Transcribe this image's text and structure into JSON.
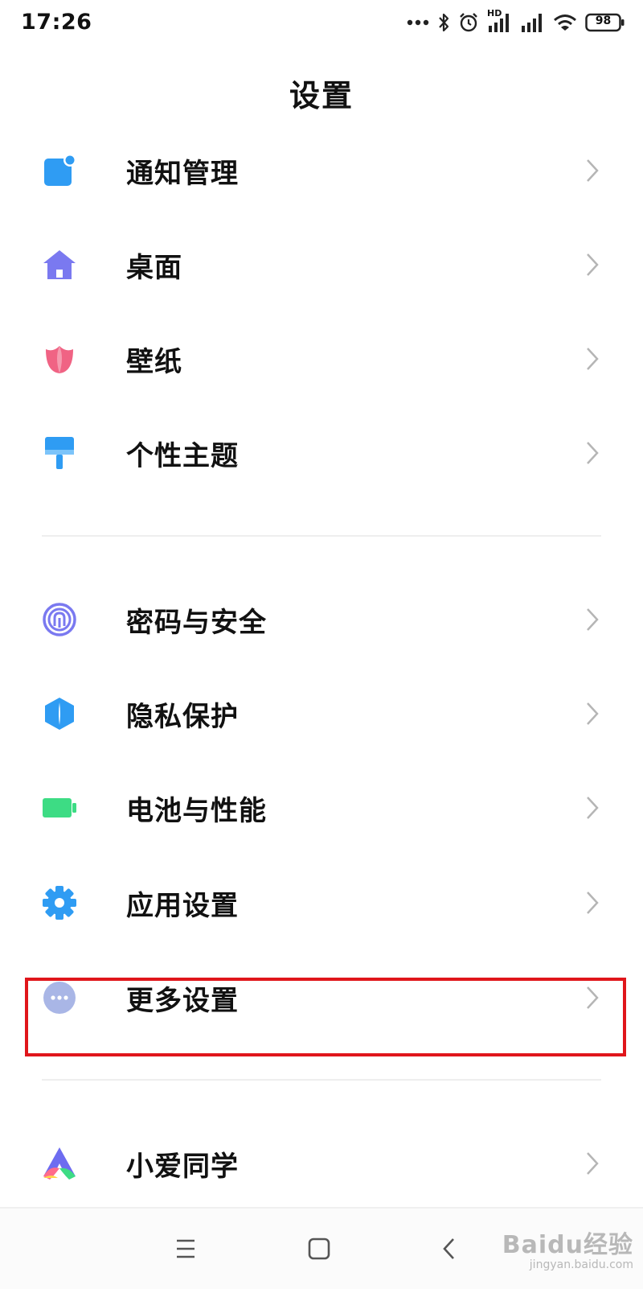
{
  "status_bar": {
    "time": "17:26",
    "network_label": "HD",
    "battery": "98",
    "icons": [
      "more-dots-icon",
      "bluetooth-icon",
      "alarm-icon",
      "signal-hd-icon",
      "signal-icon",
      "wifi-icon",
      "battery-icon"
    ]
  },
  "page": {
    "title": "设置"
  },
  "sections": [
    {
      "items": [
        {
          "id": "notifications",
          "label": "通知管理",
          "icon": "notification-icon",
          "color": "#2f9cf3"
        },
        {
          "id": "home-screen",
          "label": "桌面",
          "icon": "home-icon",
          "color": "#7a79f0"
        },
        {
          "id": "wallpaper",
          "label": "壁纸",
          "icon": "tulip-icon",
          "color": "#f06384"
        },
        {
          "id": "themes",
          "label": "个性主题",
          "icon": "paint-roller-icon",
          "color": "#2f9cf3"
        }
      ]
    },
    {
      "items": [
        {
          "id": "password-security",
          "label": "密码与安全",
          "icon": "fingerprint-icon",
          "color": "#7a79f0"
        },
        {
          "id": "privacy",
          "label": "隐私保护",
          "icon": "shield-icon",
          "color": "#2f9cf3"
        },
        {
          "id": "battery-performance",
          "label": "电池与性能",
          "icon": "battery-icon",
          "color": "#3ddc84"
        },
        {
          "id": "app-settings",
          "label": "应用设置",
          "icon": "gear-icon",
          "color": "#2f9cf3"
        },
        {
          "id": "more-settings",
          "label": "更多设置",
          "icon": "more-icon",
          "color": "#a9b6e6",
          "highlighted": true
        }
      ]
    },
    {
      "items": [
        {
          "id": "xiaoai",
          "label": "小爱同学",
          "icon": "xiaoai-icon",
          "color": "#6d6cf0"
        }
      ]
    }
  ],
  "nav_bar": {
    "icons": [
      "menu-icon",
      "home-button-icon",
      "back-icon"
    ]
  },
  "watermark": {
    "logo": "Baidu经验",
    "url": "jingyan.baidu.com"
  },
  "accent_color": "#e0161b"
}
